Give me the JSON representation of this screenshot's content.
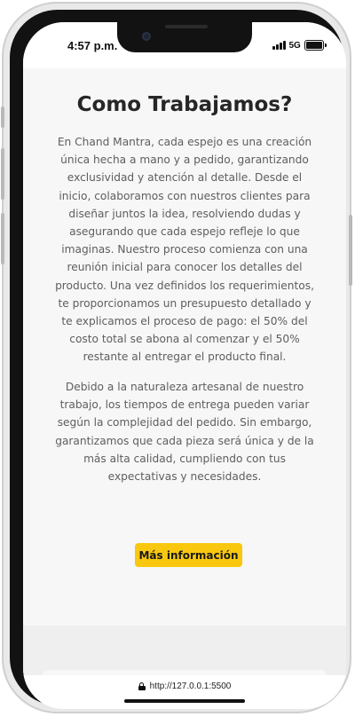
{
  "status_bar": {
    "time": "4:57 p.m.",
    "network": "5G"
  },
  "main": {
    "title": "Como Trabajamos?",
    "paragraph_1": "En Chand Mantra, cada espejo es una creación única hecha a mano y a pedido, garantizando exclusividad y atención al detalle. Desde el inicio, colaboramos con nuestros clientes para diseñar juntos la idea, resolviendo dudas y asegurando que cada espejo refleje lo que imaginas. Nuestro proceso comienza con una reunión inicial para conocer los detalles del producto. Una vez definidos los requerimientos, te proporcionamos un presupuesto detallado y te explicamos el proceso de pago: el 50% del costo total se abona al comenzar y el 50% restante al entregar el producto final.",
    "paragraph_2": "Debido a la naturaleza artesanal de nuestro trabajo, los tiempos de entrega pueden variar según la complejidad del pedido. Sin embargo, garantizamos que cada pieza será única y de la más alta calidad, cumpliendo con tus expectativas y necesidades.",
    "cta_label": "Más información"
  },
  "browser": {
    "url": "http://127.0.0.1:5500"
  },
  "colors": {
    "accent": "#f9c80e",
    "title": "#262626",
    "body_text": "#5e5e5e",
    "page_bg": "#f7f7f7"
  },
  "icons": {
    "status": [
      "signal-icon",
      "battery-icon"
    ],
    "url": "lock-icon"
  }
}
